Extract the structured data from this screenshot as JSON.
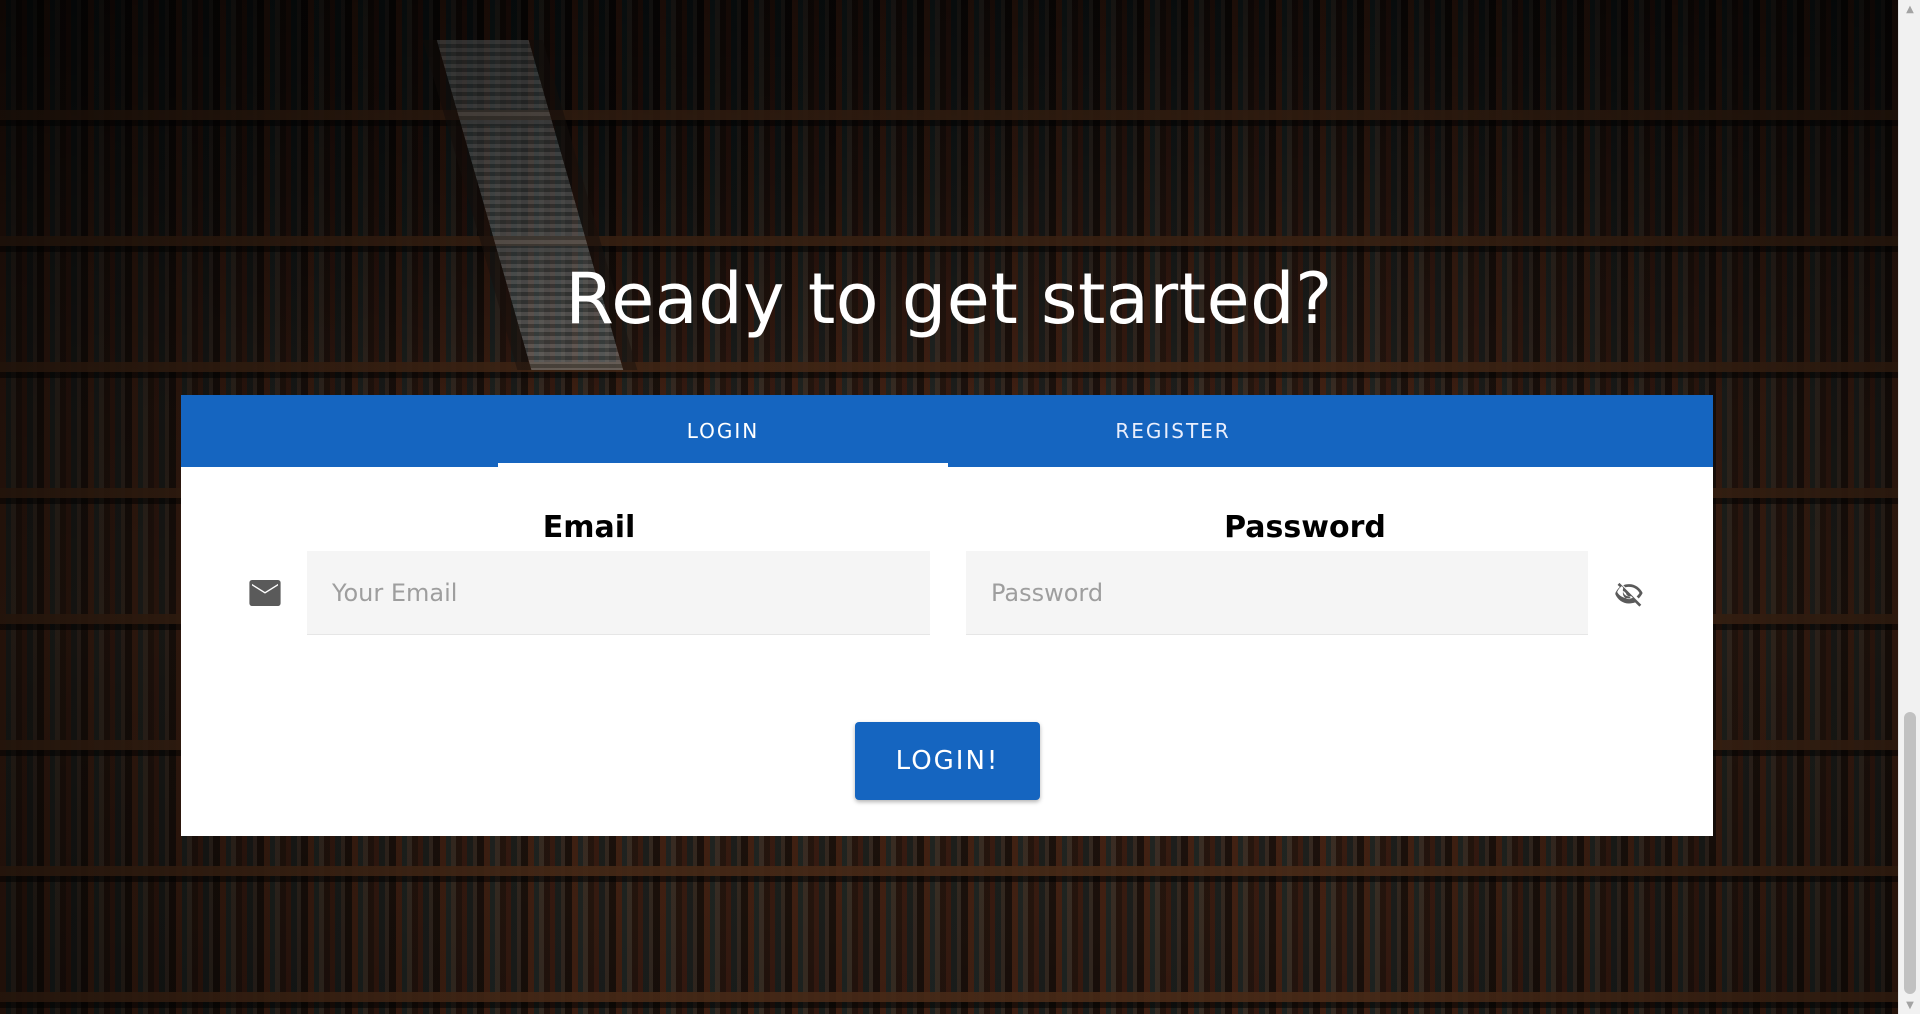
{
  "section": {
    "heading": "Ready to get started?"
  },
  "tabs": [
    {
      "label": "LOGIN",
      "active": true
    },
    {
      "label": "REGISTER",
      "active": false
    }
  ],
  "form": {
    "email": {
      "label": "Email",
      "placeholder": "Your Email",
      "value": "",
      "icon": "mail-icon"
    },
    "password": {
      "label": "Password",
      "placeholder": "Password",
      "value": "",
      "icon": "visibility-off-icon"
    },
    "submit_label": "LOGIN!"
  },
  "colors": {
    "primary": "#1565c0",
    "card_bg": "#ffffff",
    "input_bg": "#f5f5f5",
    "heading_text": "#ffffff"
  }
}
